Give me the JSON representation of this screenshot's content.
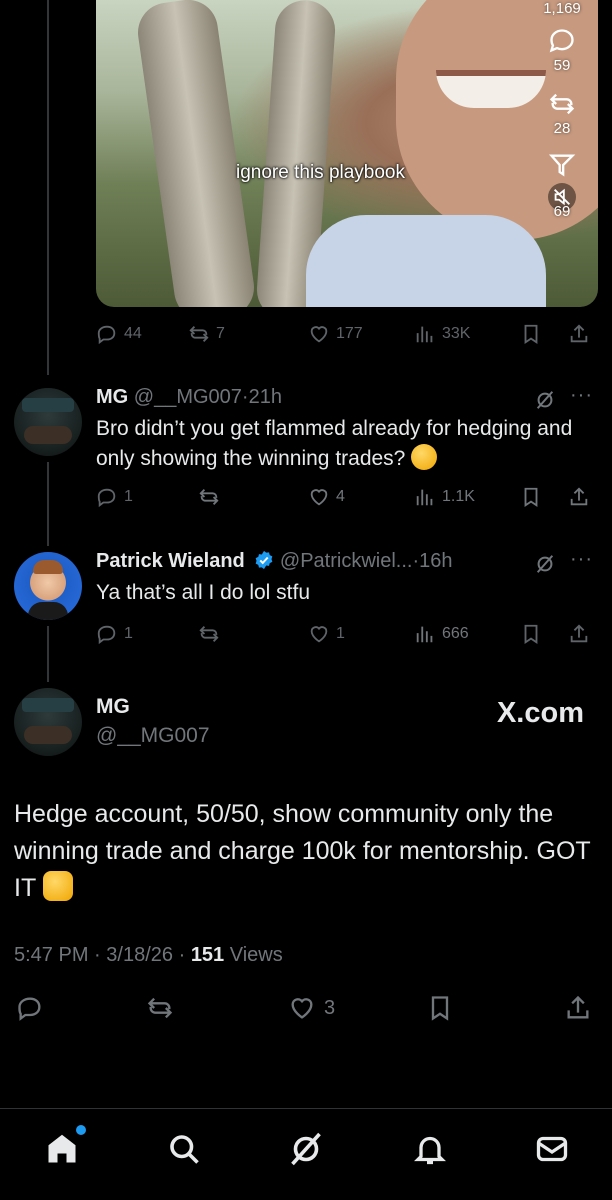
{
  "video": {
    "caption": "ignore this playbook",
    "views_count": "1,169",
    "replies_count": "59",
    "reposts_count": "28",
    "shares_count": "69"
  },
  "parent_actions": {
    "replies": "44",
    "reposts": "7",
    "likes": "177",
    "views": "33K"
  },
  "reply1": {
    "name": "MG",
    "handle": "@__MG007",
    "sep": "·",
    "time": "21h",
    "text": "Bro didn’t you get flammed already for hedging and only showing the winning trades?",
    "emoji": "thinking-face",
    "actions": {
      "replies": "1",
      "reposts": "",
      "likes": "4",
      "views": "1.1K"
    }
  },
  "reply2": {
    "name": "Patrick Wieland",
    "handle": "@Patrickwiel...",
    "sep": "·",
    "time": "16h",
    "text": "Ya that’s all I do lol stfu",
    "actions": {
      "replies": "1",
      "reposts": "",
      "likes": "1",
      "views": "666"
    }
  },
  "main": {
    "name": "MG",
    "handle": "@__MG007",
    "watermark": "X.com",
    "text": "Hedge account, 50/50, show community only the winning trade and charge 100k for mentorship. GOT IT",
    "emoji": "thumbs-up",
    "time": "5:47 PM",
    "sep1": "·",
    "date": "3/18/26",
    "sep2": "·",
    "views": "151",
    "views_label": "Views",
    "likes": "3"
  },
  "more_label": "···",
  "colors": {
    "accent": "#1d9bf0",
    "muted": "#71767b",
    "text": "#e7e9ea",
    "bg": "#000000"
  }
}
